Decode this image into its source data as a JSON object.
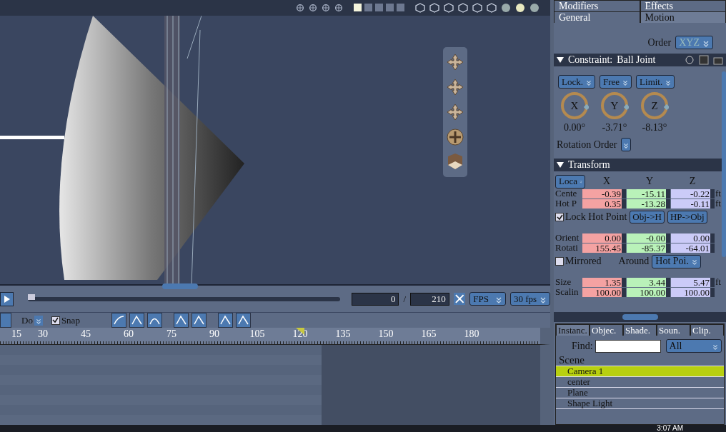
{
  "toolbar": {
    "layouts": [
      {
        "selected": true
      },
      {
        "selected": false
      },
      {
        "selected": false
      },
      {
        "selected": false
      },
      {
        "selected": false
      }
    ]
  },
  "transport": {
    "level": 0,
    "frame": "0",
    "separator": "/",
    "end_frame": "210",
    "rate_mode": "FPS",
    "rate": "30 fps"
  },
  "timeline_toolbar": {
    "mode": "Do",
    "snap": {
      "label": "Snap",
      "checked": true
    }
  },
  "ruler": [
    {
      "text": "15",
      "current": false
    },
    {
      "text": "30",
      "current": false
    },
    {
      "text": "45",
      "current": false
    },
    {
      "text": "60",
      "current": false
    },
    {
      "text": "75",
      "current": false
    },
    {
      "text": "90",
      "current": false
    },
    {
      "text": "105",
      "current": false
    },
    {
      "text": "120",
      "current": true
    },
    {
      "text": "135",
      "current": false
    },
    {
      "text": "150",
      "current": false
    },
    {
      "text": "165",
      "current": false
    },
    {
      "text": "180",
      "current": false
    }
  ],
  "properties": {
    "tabs_back": [
      {
        "label": "Modifiers",
        "selected": false
      },
      {
        "label": "Effects",
        "selected": false
      }
    ],
    "tabs_front": [
      {
        "label": "General",
        "selected": false
      },
      {
        "label": "Motion",
        "selected": true
      }
    ],
    "order_label": "Order",
    "order": "XYZ",
    "constraint": {
      "title": "Constraint:",
      "type": "Ball Joint",
      "modes": [
        "Lock.",
        "Free",
        "Limit."
      ],
      "dials": [
        {
          "axis": "X",
          "value": "0.00°"
        },
        {
          "axis": "Y",
          "value": "-3.71°"
        },
        {
          "axis": "Z",
          "value": "-8.13°"
        }
      ],
      "rotation_order_label": "Rotation Order"
    },
    "transform": {
      "title": "Transform",
      "space": "Loca",
      "columns": [
        "X",
        "Y",
        "Z"
      ],
      "rows": [
        {
          "label": "Cente",
          "values": [
            "-0.39",
            "-15.11",
            "-0.22"
          ],
          "unit": "ft"
        },
        {
          "label": "Hot P",
          "values": [
            "0.35",
            "-13.28",
            "-0.11"
          ],
          "unit": "ft"
        },
        {
          "kind": "lock",
          "label": "Lock Hot Point",
          "checked": true,
          "buttons": [
            "Obj->H",
            "HP->Obj"
          ]
        },
        {
          "label": "Orient",
          "values": [
            "0.00",
            "-0.00",
            "0.00"
          ]
        },
        {
          "label": "Rotati",
          "values": [
            "155.45",
            "-85.37",
            "-64.01"
          ]
        },
        {
          "kind": "mirror",
          "label": "Mirrored",
          "checked": false,
          "around_label": "Around",
          "around": "Hot Poi."
        },
        {
          "label": "Size",
          "values": [
            "1.35",
            "3.44",
            "5.47"
          ],
          "unit": "ft"
        },
        {
          "label": "Scalin",
          "values": [
            "100.00",
            "100.00",
            "100.00"
          ]
        }
      ]
    }
  },
  "browser": {
    "tabs": [
      {
        "label": "Instanc.",
        "selected": true
      },
      {
        "label": "Objec.",
        "selected": false
      },
      {
        "label": "Shade.",
        "selected": false
      },
      {
        "label": "Soun.",
        "selected": false
      },
      {
        "label": "Clip.",
        "selected": false
      }
    ],
    "find_label": "Find:",
    "filter": "All",
    "tree": [
      {
        "label": "Scene",
        "selected": false,
        "children": [
          {
            "label": "Camera 1",
            "selected": true
          },
          {
            "label": "center",
            "selected": false
          },
          {
            "label": "Plane",
            "selected": false
          },
          {
            "label": "Shape Light",
            "selected": false
          }
        ]
      }
    ]
  },
  "taskbar": {
    "clock": "3:07 AM"
  }
}
